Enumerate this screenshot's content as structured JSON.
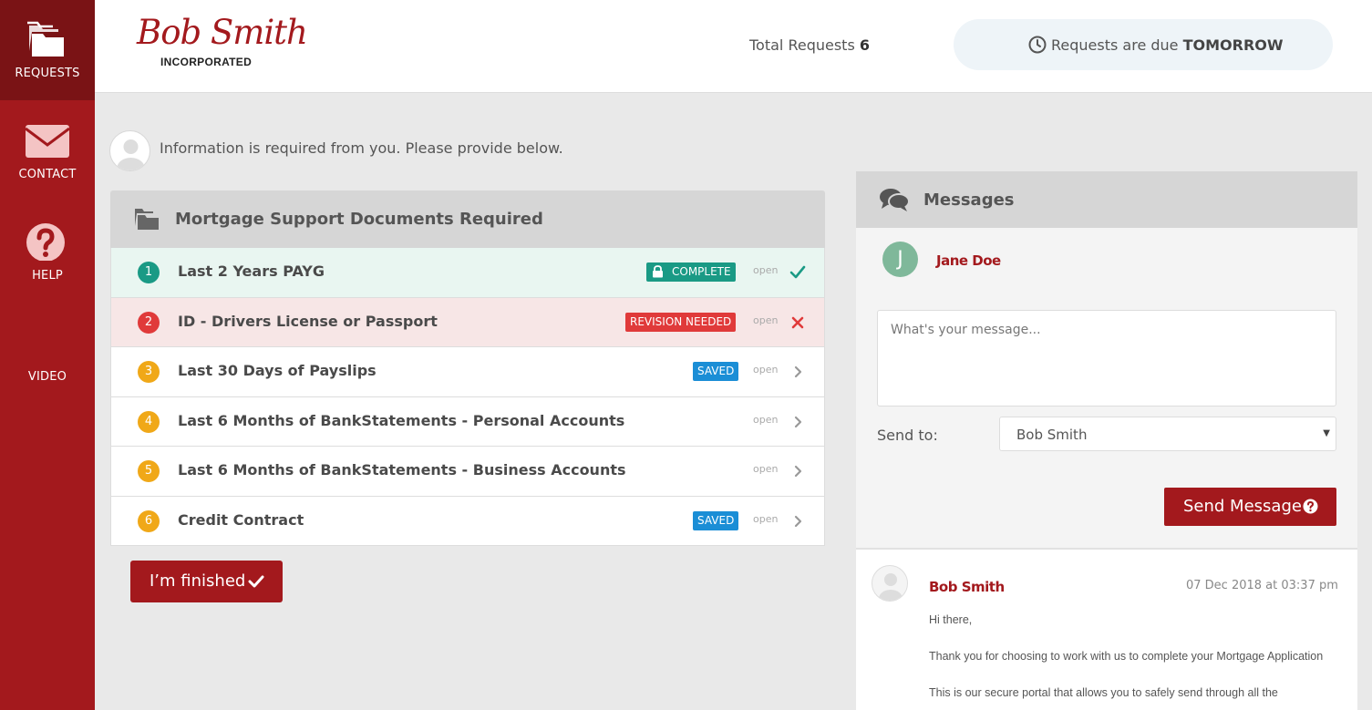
{
  "sidebar": {
    "items": [
      {
        "label": "REQUESTS",
        "icon": "folders-icon"
      },
      {
        "label": "CONTACT",
        "icon": "envelope-icon"
      },
      {
        "label": "HELP",
        "icon": "question-icon"
      },
      {
        "label": "VIDEO",
        "icon": "video-icon"
      }
    ]
  },
  "header": {
    "logo_script": "Bob Smith",
    "logo_sub": "INCORPORATED",
    "total_label": "Total Requests",
    "total_count": "6",
    "due_prefix": "Requests are due",
    "due_value": "TOMORROW"
  },
  "intro": {
    "text": "Information is required from you. Please provide below."
  },
  "documents": {
    "title": "Mortgage Support Documents Required",
    "rows": [
      {
        "num": "1",
        "title": "Last 2 Years PAYG",
        "badge": "COMPLETE",
        "open": "open",
        "status": "check"
      },
      {
        "num": "2",
        "title": "ID - Drivers License or Passport",
        "badge": "REVISION NEEDED",
        "open": "open",
        "status": "cross"
      },
      {
        "num": "3",
        "title": "Last 30 Days of Payslips",
        "badge": "SAVED",
        "open": "open",
        "status": "chevron"
      },
      {
        "num": "4",
        "title": "Last 6 Months of BankStatements - Personal Accounts",
        "badge": "",
        "open": "open",
        "status": "chevron"
      },
      {
        "num": "5",
        "title": "Last 6 Months of BankStatements - Business Accounts",
        "badge": "",
        "open": "open",
        "status": "chevron"
      },
      {
        "num": "6",
        "title": "Credit Contract",
        "badge": "SAVED",
        "open": "open",
        "status": "chevron"
      }
    ],
    "finish_label": "I’m finished"
  },
  "messages": {
    "title": "Messages",
    "user_initial": "J",
    "user_name": "Jane Doe",
    "input_placeholder": "What's your message...",
    "send_to_label": "Send to:",
    "send_to_value": "Bob Smith",
    "send_label": "Send Message",
    "thread": {
      "author": "Bob Smith",
      "date": "07 Dec 2018 at 03:37 pm",
      "paragraphs": [
        "Hi there,",
        "Thank you for choosing to work with us to complete your Mortgage Application",
        "This is our secure portal that allows you to safely send through all the"
      ]
    }
  },
  "colors": {
    "brand": "#a3191d",
    "complete": "#1a9a85",
    "revision": "#e03a3a",
    "saved": "#1b8ed6",
    "pending": "#f0a818"
  }
}
